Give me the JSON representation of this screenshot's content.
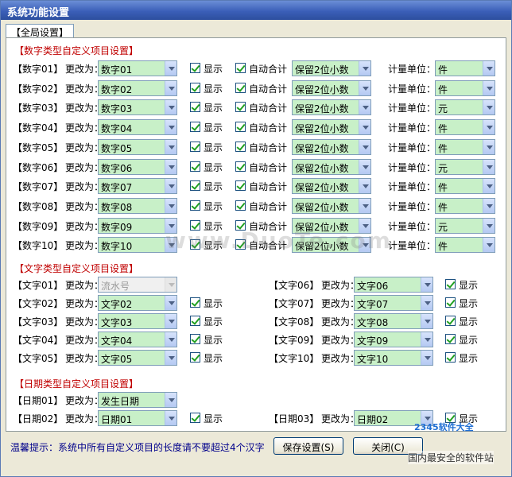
{
  "window": {
    "title": "系统功能设置"
  },
  "tab": {
    "label": "【全局设置】"
  },
  "sections": {
    "number": "【数字类型自定义项目设置】",
    "text": "【文字类型自定义项目设置】",
    "date": "【日期类型自定义项目设置】"
  },
  "labels": {
    "rename": "更改为：",
    "show": "显示",
    "autosum": "自动合计",
    "unit": "计量单位："
  },
  "numbers": [
    {
      "tag": "【数字01】",
      "name": "数字01",
      "show": true,
      "autosum": true,
      "decimal": "保留2位小数",
      "unit": "件"
    },
    {
      "tag": "【数字02】",
      "name": "数字02",
      "show": true,
      "autosum": true,
      "decimal": "保留2位小数",
      "unit": "件"
    },
    {
      "tag": "【数字03】",
      "name": "数字03",
      "show": true,
      "autosum": true,
      "decimal": "保留2位小数",
      "unit": "元"
    },
    {
      "tag": "【数字04】",
      "name": "数字04",
      "show": true,
      "autosum": true,
      "decimal": "保留2位小数",
      "unit": "件"
    },
    {
      "tag": "【数字05】",
      "name": "数字05",
      "show": true,
      "autosum": true,
      "decimal": "保留2位小数",
      "unit": "件"
    },
    {
      "tag": "【数字06】",
      "name": "数字06",
      "show": true,
      "autosum": true,
      "decimal": "保留2位小数",
      "unit": "元"
    },
    {
      "tag": "【数字07】",
      "name": "数字07",
      "show": true,
      "autosum": true,
      "decimal": "保留2位小数",
      "unit": "件"
    },
    {
      "tag": "【数字08】",
      "name": "数字08",
      "show": true,
      "autosum": true,
      "decimal": "保留2位小数",
      "unit": "件"
    },
    {
      "tag": "【数字09】",
      "name": "数字09",
      "show": true,
      "autosum": true,
      "decimal": "保留2位小数",
      "unit": "元"
    },
    {
      "tag": "【数字10】",
      "name": "数字10",
      "show": true,
      "autosum": true,
      "decimal": "保留2位小数",
      "unit": "件"
    }
  ],
  "texts_left": [
    {
      "tag": "【文字01】",
      "name": "流水号",
      "show": false,
      "disabled": true
    },
    {
      "tag": "【文字02】",
      "name": "文字02",
      "show": true
    },
    {
      "tag": "【文字03】",
      "name": "文字03",
      "show": true
    },
    {
      "tag": "【文字04】",
      "name": "文字04",
      "show": true
    },
    {
      "tag": "【文字05】",
      "name": "文字05",
      "show": true
    }
  ],
  "texts_right": [
    {
      "tag": "【文字06】",
      "name": "文字06",
      "show": true
    },
    {
      "tag": "【文字07】",
      "name": "文字07",
      "show": true
    },
    {
      "tag": "【文字08】",
      "name": "文字08",
      "show": true
    },
    {
      "tag": "【文字09】",
      "name": "文字09",
      "show": true
    },
    {
      "tag": "【文字10】",
      "name": "文字10",
      "show": true
    }
  ],
  "dates": [
    {
      "tag": "【日期01】",
      "name": "发生日期",
      "show": false
    },
    {
      "tag": "【日期02】",
      "name": "日期01",
      "show": true
    },
    {
      "tag": "【日期03】",
      "name": "日期02",
      "show": true
    }
  ],
  "footer": {
    "hint": "温馨提示：系统中所有自定义项目的长度请不要超过4个汉字",
    "save": "保存设置(S)",
    "close": "关闭(C)"
  },
  "watermarks": {
    "center": "www.DuoTe.com",
    "corner": "2345软件大全",
    "corner_sub": "国内最安全的软件站"
  },
  "colors": {
    "title": "#c00000",
    "field_bg": "#c8f0c8",
    "hint": "#00008b"
  }
}
